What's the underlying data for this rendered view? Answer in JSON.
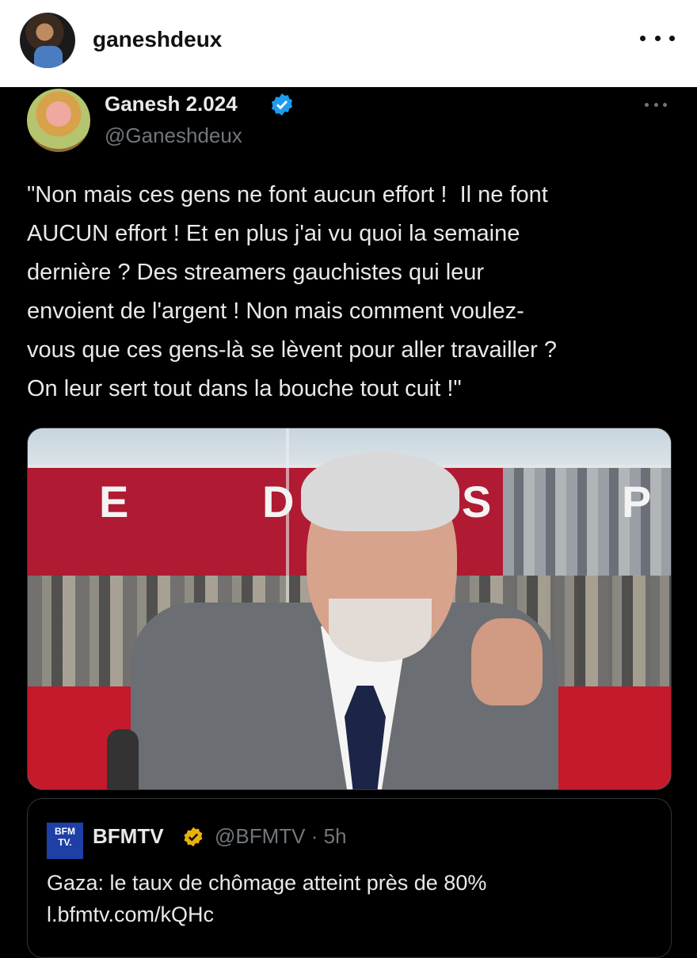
{
  "instagram": {
    "username": "ganeshdeux"
  },
  "tweet": {
    "display_name": "Ganesh 2.024",
    "handle": "@Ganeshdeux",
    "text": "\"Non mais ces gens ne font aucun effort !  Il ne font\nAUCUN effort ! Et en plus j'ai vu quoi la semaine\ndernière ? Des streamers gauchistes qui leur\nenvoient de l'argent ! Non mais comment voulez-\nvous que ces gens-là se lèvent pour aller travailler ?\nOn leur sert tout dans la bouche tout cuit !\"",
    "media_letters": [
      "E",
      "D",
      "S",
      "P"
    ],
    "quoted": {
      "logo_text": "BFM TV.",
      "display_name": "BFMTV",
      "handle_time": "@BFMTV · 5h",
      "text": "Gaza: le taux de chômage atteint près de 80%",
      "link": "l.bfmtv.com/kQHc"
    }
  },
  "colors": {
    "verified_blue": "#1d9bf0",
    "verified_gold": "#e8b10e",
    "text_primary": "#e7e9ea",
    "text_secondary": "#71767b"
  },
  "icons": [
    "more-options-icon",
    "verified-badge-icon",
    "gold-verified-badge-icon"
  ]
}
